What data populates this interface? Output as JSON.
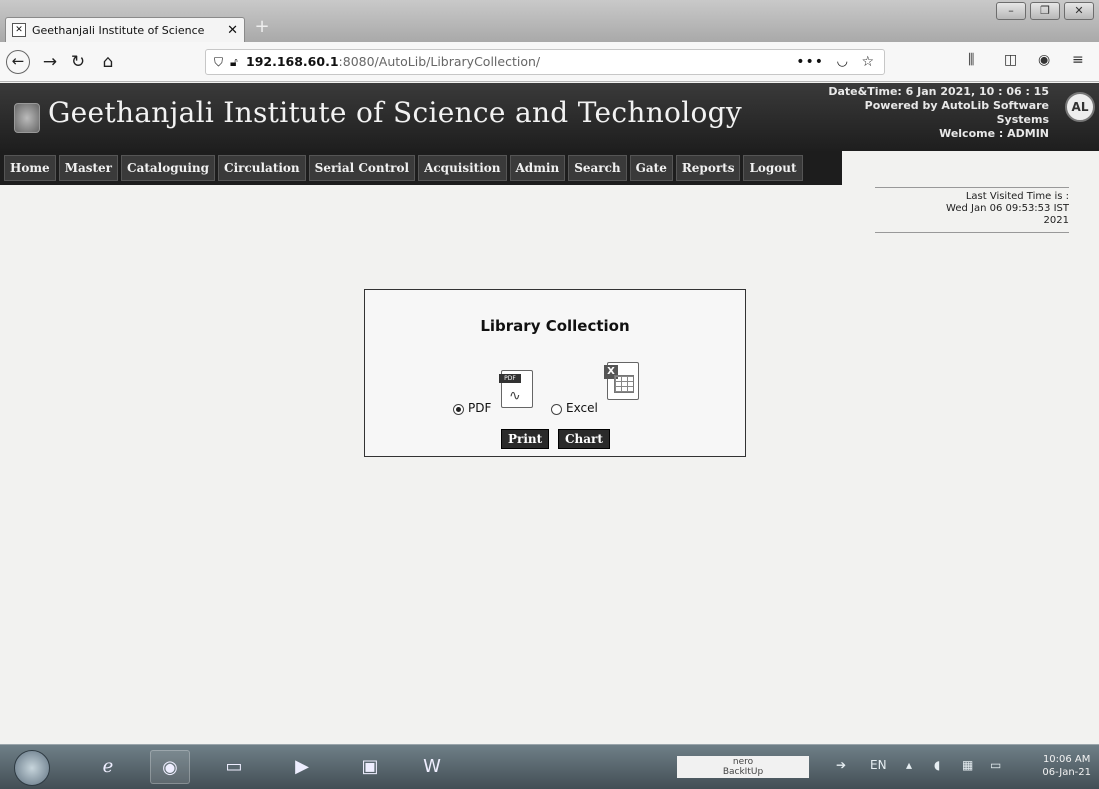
{
  "browser": {
    "tab_title": "Geethanjali Institute of Science",
    "tab_close": "✕",
    "new_tab": "+",
    "url_host": "192.168.60.1",
    "url_path": ":8080/AutoLib/LibraryCollection/",
    "more_label": "•••"
  },
  "header": {
    "title": "Geethanjali Institute of Science and Technology",
    "datetime": "Date&Time:  6 Jan 2021, 10 : 06 : 15",
    "powered_by_1": "Powered by AutoLib Software",
    "powered_by_2": "Systems",
    "welcome": "Welcome   :  ADMIN"
  },
  "menu": [
    "Home",
    "Master",
    "Cataloguing",
    "Circulation",
    "Serial Control",
    "Acquisition",
    "Admin",
    "Search",
    "Gate",
    "Reports",
    "Logout"
  ],
  "last_visited": {
    "label": "Last Visited Time is :",
    "value": "Wed Jan 06 09:53:53 IST",
    "year": "2021"
  },
  "dialog": {
    "title": "Library Collection",
    "pdf_label": "PDF",
    "excel_label": "Excel",
    "pdf_badge": "PDF",
    "selected": "PDF",
    "print_label": "Print",
    "chart_label": "Chart"
  },
  "taskbar": {
    "nero_label": "nero",
    "nero_sub": "BackItUp",
    "lang": "EN",
    "time": "10:06 AM",
    "date": "06-Jan-21"
  }
}
